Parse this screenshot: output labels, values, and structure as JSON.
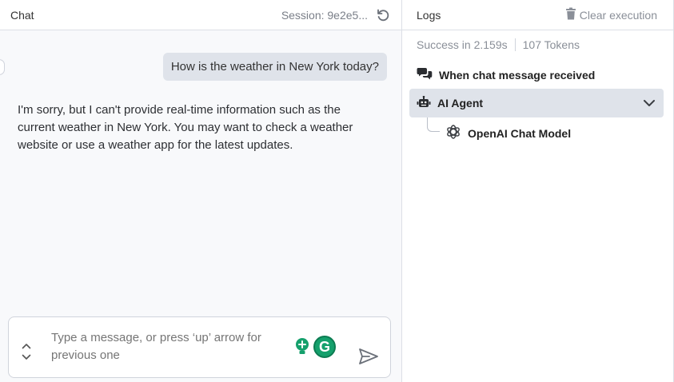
{
  "chat": {
    "title": "Chat",
    "session": "Session: 9e2e5...",
    "messages": {
      "user": "How is the weather in New York today?",
      "bot": "I'm sorry, but I can't provide real-time information such as the current weather in New York. You may want to check a weather website or use a weather app for the latest updates."
    },
    "input": {
      "placeholder": "Type a message, or press ‘up’ arrow for previous one",
      "value": ""
    },
    "icons": {
      "reset": "reset-session-icon",
      "send": "send-icon",
      "history_up": "chevron-up-icon",
      "history_down": "chevron-down-icon",
      "grammar": "grammarly-icon"
    }
  },
  "logs": {
    "title": "Logs",
    "clear_label": "Clear execution",
    "summary": {
      "status": "Success in 2.159s",
      "tokens": "107 Tokens"
    },
    "entries": [
      {
        "label": "When chat message received",
        "icon": "chat-bubbles-icon"
      },
      {
        "label": "AI Agent",
        "icon": "robot-icon",
        "selected": true,
        "expanded": true
      },
      {
        "label": "OpenAI Chat Model",
        "icon": "openai-icon"
      }
    ]
  },
  "colors": {
    "chat_bg": "#f8f9fb",
    "user_bubble": "#dfe3ea",
    "selected_row": "#dfe3ea",
    "muted_text": "#8a8f98",
    "grammarly_green": "#15a06c"
  }
}
